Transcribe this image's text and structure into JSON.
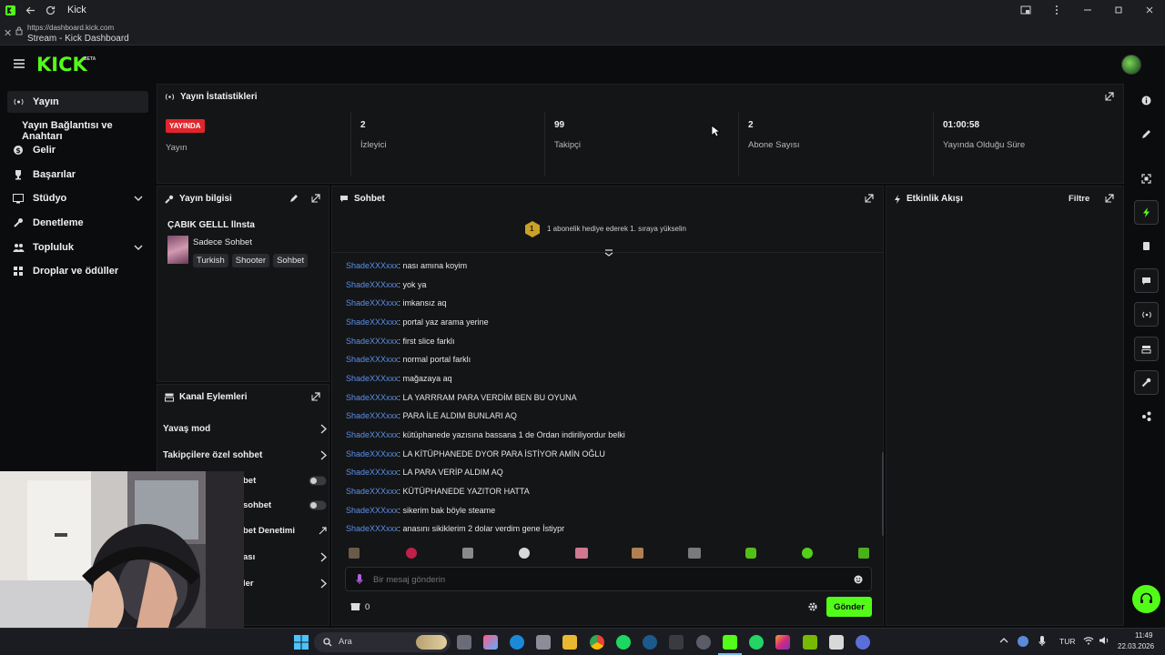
{
  "browser": {
    "tab_title": "Kick",
    "url": "https://dashboard.kick.com",
    "page_title": "Stream - Kick Dashboard"
  },
  "header": {
    "logo": "KICK",
    "logo_tag": "BETA"
  },
  "sidebar": {
    "items": [
      {
        "label": "Yayın",
        "icon": "broadcast-icon",
        "active": true
      },
      {
        "label": "Yayın Bağlantısı ve Anahtarı",
        "sub": true
      },
      {
        "label": "Gelir",
        "icon": "money-icon"
      },
      {
        "label": "Başarılar",
        "icon": "trophy-icon"
      },
      {
        "label": "Stüdyo",
        "icon": "studio-icon",
        "expandable": true
      },
      {
        "label": "Denetleme",
        "icon": "wrench-icon"
      },
      {
        "label": "Topluluk",
        "icon": "community-icon",
        "expandable": true
      },
      {
        "label": "Droplar ve ödüller",
        "icon": "drops-icon"
      }
    ]
  },
  "stats_panel": {
    "title": "Yayın İstatistikleri",
    "live_badge": "YAYINDA",
    "live_label": "Yayın",
    "stats": [
      {
        "value": "2",
        "label": "İzleyici"
      },
      {
        "value": "99",
        "label": "Takipçi"
      },
      {
        "value": "2",
        "label": "Abone Sayısı"
      },
      {
        "value": "01:00:58",
        "label": "Yayında Olduğu Süre"
      }
    ]
  },
  "stream_info": {
    "title": "Yayın bilgisi",
    "stream_title": "ÇABIK GELLL llnsta",
    "category": "Sadece Sohbet",
    "tags": [
      "Turkish",
      "Shooter",
      "Sohbet"
    ]
  },
  "channel_actions": {
    "title": "Kanal Eylemleri",
    "items": [
      {
        "label": "Yavaş mod",
        "type": "arrow"
      },
      {
        "label": "Takipçilere özel sohbet",
        "type": "arrow"
      },
      {
        "label": "bet",
        "type": "toggle"
      },
      {
        "label": "sohbet",
        "type": "toggle"
      },
      {
        "label": "bet Denetimi",
        "type": "external"
      },
      {
        "label": "ası",
        "type": "arrow"
      },
      {
        "label": "ler",
        "type": "arrow"
      }
    ]
  },
  "chat": {
    "title": "Sohbet",
    "gift_badge": "1",
    "gift_prompt": "1 abonelik hediye ederek 1. sıraya yükselin",
    "messages": [
      {
        "user": "ShadeXXXxxx",
        "text": ": nası amına koyim"
      },
      {
        "user": "ShadeXXXxxx",
        "text": ": yok ya"
      },
      {
        "user": "ShadeXXXxxx",
        "text": ": imkansız aq"
      },
      {
        "user": "ShadeXXXxxx",
        "text": ": portal yaz arama yerine"
      },
      {
        "user": "ShadeXXXxxx",
        "text": ": first slice farklı"
      },
      {
        "user": "ShadeXXXxxx",
        "text": ": normal portal farklı"
      },
      {
        "user": "ShadeXXXxxx",
        "text": ": mağazaya aq"
      },
      {
        "user": "ShadeXXXxxx",
        "text": ": LA YARRRAM PARA VERDİM BEN BU OYUNA"
      },
      {
        "user": "ShadeXXXxxx",
        "text": ": PARA İLE ALDIM BUNLARI AQ"
      },
      {
        "user": "ShadeXXXxxx",
        "text": ": kütüphanede yazısına bassana 1 de Ordan indiriliyordur belki"
      },
      {
        "user": "ShadeXXXxxx",
        "text": ": LA KİTÜPHANEDE DYOR PARA İSTİYOR AMİN OĞLU"
      },
      {
        "user": "ShadeXXXxxx",
        "text": ": LA PARA VERİP ALDIM AQ"
      },
      {
        "user": "ShadeXXXxxx",
        "text": ": KÜTÜPHANEDE YAZITOR HATTA"
      },
      {
        "user": "ShadeXXXxxx",
        "text": ": sikerim bak böyle steame"
      },
      {
        "user": "ShadeXXXxxx",
        "text": ": anasını sikiklerim 2 dolar verdim gene İstiypr"
      }
    ],
    "input_placeholder": "Bir mesaj gönderin",
    "points": "0",
    "send_label": "Gönder"
  },
  "activity": {
    "title": "Etkinlik Akışı",
    "filter_label": "Filtre"
  },
  "taskbar": {
    "search": "Ara",
    "lang": "TUR",
    "time": "11:49",
    "date": "22.03.2026"
  },
  "colors": {
    "accent": "#53fc18",
    "live": "#e0262c",
    "username": "#5b8fe8"
  }
}
